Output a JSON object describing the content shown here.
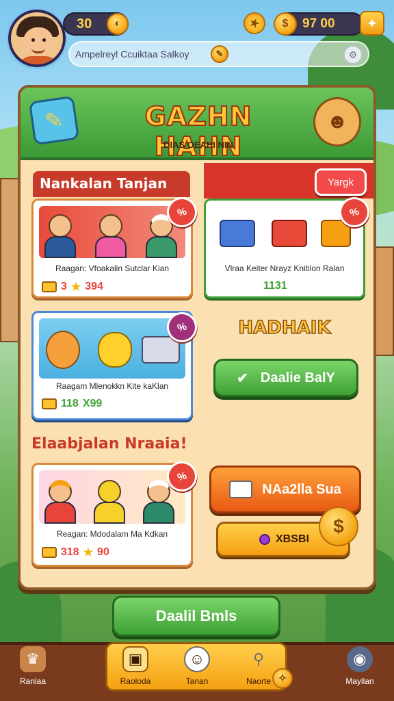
{
  "hud": {
    "level": "30",
    "coins": "97  00",
    "gem_icon": "sparkle-icon",
    "subtitle": "Ampelreyl Ccuiktaa Salkoy"
  },
  "panel": {
    "title": "GAZHN HAHN",
    "subtitle": "DIAS OEAHI NIN"
  },
  "section1": {
    "tab_label": "Nankalan Tanjan",
    "tag_button": "Yargk"
  },
  "cards": [
    {
      "badge": "%",
      "caption": "Raagan: Vfoakalin Sutclar Kian",
      "stat_a": "3",
      "stat_b": "394"
    },
    {
      "badge": "%",
      "caption": "Vlraa Keiter Nrayz Knitilon Ralan",
      "stat_a": "1131",
      "stat_b": ""
    },
    {
      "badge": "%",
      "caption": "Raagam Mlenokkn Kite kaKlan",
      "stat_a": "118",
      "stat_b": "X99"
    },
    {
      "badge": "%",
      "caption": "Reagan: Mdodalam Ma Kdkan",
      "stat_a": "318",
      "stat_b": "90"
    }
  ],
  "right_panel": {
    "heading": "HADHAIK",
    "primary_button": "Daalie BalY",
    "orange_button": "NAa2lla Sua",
    "coin_row_text": "XBSBI"
  },
  "section2": {
    "label": "Elaabjalan Nraaia!"
  },
  "footer_button": "Daalil Bmls",
  "nav": {
    "items": [
      "Ranlaa",
      "Raoloda",
      "Tanan",
      "Naorte",
      "Mayllan"
    ]
  },
  "colors": {
    "accent_green": "#3ea035",
    "accent_red": "#d9342a",
    "gold": "#ffc93a"
  }
}
